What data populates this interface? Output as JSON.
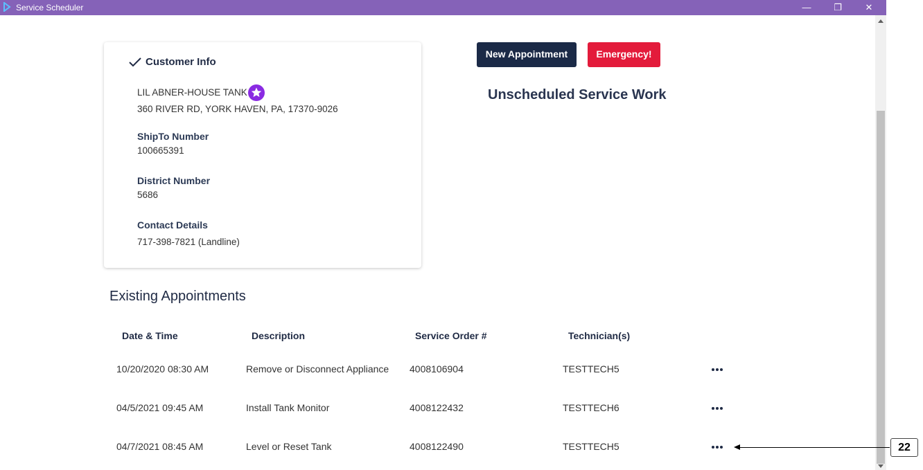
{
  "window": {
    "title": "Service Scheduler",
    "minimize_glyph": "—",
    "restore_glyph": "❐",
    "close_glyph": "✕"
  },
  "customer_info": {
    "title": "Customer Info",
    "name": "LIL ABNER-HOUSE TANK",
    "address": "360 RIVER RD, YORK HAVEN, PA, 17370-9026",
    "shipto_label": "ShipTo Number",
    "shipto_value": "100665391",
    "district_label": "District Number",
    "district_value": "5686",
    "contact_label": "Contact Details",
    "contact_value": "717-398-7821 (Landline)"
  },
  "actions": {
    "new_appointment": "New Appointment",
    "emergency": "Emergency!"
  },
  "unscheduled_title": "Unscheduled Service Work",
  "appointments": {
    "title": "Existing Appointments",
    "headers": {
      "datetime": "Date & Time",
      "description": "Description",
      "order": "Service Order #",
      "technician": "Technician(s)"
    },
    "rows": [
      {
        "datetime": "10/20/2020 08:30 AM",
        "description": "Remove or Disconnect Appliance",
        "order": "4008106904",
        "technician": "TESTTECH5"
      },
      {
        "datetime": "04/5/2021 09:45 AM",
        "description": "Install Tank Monitor",
        "order": "4008122432",
        "technician": "TESTTECH6"
      },
      {
        "datetime": "04/7/2021 08:45 AM",
        "description": "Level or Reset Tank",
        "order": "4008122490",
        "technician": "TESTTECH5"
      }
    ]
  },
  "annotation": {
    "label": "22"
  },
  "colors": {
    "titlebar": "#8562b8",
    "primary_button": "#1b2a47",
    "emergency_button": "#e31b3b",
    "star_badge": "#8a2be2"
  }
}
